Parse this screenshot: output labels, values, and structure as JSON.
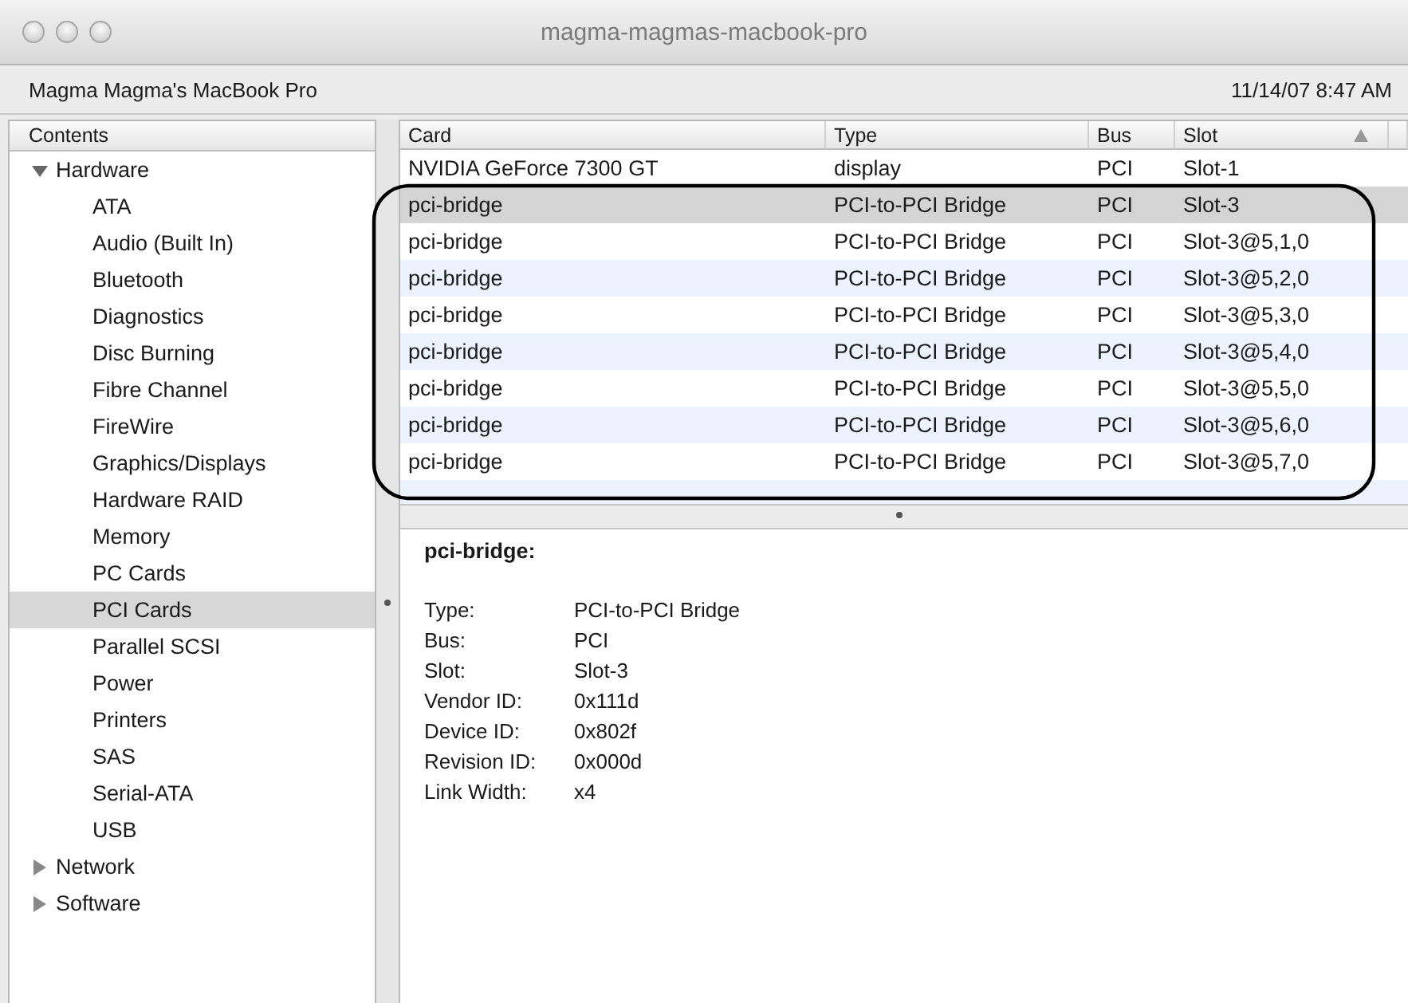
{
  "window": {
    "title": "magma-magmas-macbook-pro"
  },
  "info_bar": {
    "computer_name": "Magma Magma's MacBook Pro",
    "timestamp": "11/14/07 8:47 AM"
  },
  "sidebar": {
    "header": "Contents",
    "items": [
      {
        "label": "Hardware",
        "expanded": true,
        "selected": false,
        "children": [
          {
            "label": "ATA",
            "selected": false
          },
          {
            "label": "Audio (Built In)",
            "selected": false
          },
          {
            "label": "Bluetooth",
            "selected": false
          },
          {
            "label": "Diagnostics",
            "selected": false
          },
          {
            "label": "Disc Burning",
            "selected": false
          },
          {
            "label": "Fibre Channel",
            "selected": false
          },
          {
            "label": "FireWire",
            "selected": false
          },
          {
            "label": "Graphics/Displays",
            "selected": false
          },
          {
            "label": "Hardware RAID",
            "selected": false
          },
          {
            "label": "Memory",
            "selected": false
          },
          {
            "label": "PC Cards",
            "selected": false
          },
          {
            "label": "PCI Cards",
            "selected": true
          },
          {
            "label": "Parallel SCSI",
            "selected": false
          },
          {
            "label": "Power",
            "selected": false
          },
          {
            "label": "Printers",
            "selected": false
          },
          {
            "label": "SAS",
            "selected": false
          },
          {
            "label": "Serial-ATA",
            "selected": false
          },
          {
            "label": "USB",
            "selected": false
          }
        ]
      },
      {
        "label": "Network",
        "expanded": false,
        "selected": false
      },
      {
        "label": "Software",
        "expanded": false,
        "selected": false
      }
    ]
  },
  "table": {
    "columns": [
      {
        "label": "Card",
        "sorted": false
      },
      {
        "label": "Type",
        "sorted": false
      },
      {
        "label": "Bus",
        "sorted": false
      },
      {
        "label": "Slot",
        "sorted": true
      }
    ],
    "rows": [
      {
        "cells": [
          "NVIDIA GeForce 7300 GT",
          "display",
          "PCI",
          "Slot-1"
        ],
        "selected": false
      },
      {
        "cells": [
          "pci-bridge",
          "PCI-to-PCI Bridge",
          "PCI",
          "Slot-3"
        ],
        "selected": true
      },
      {
        "cells": [
          "pci-bridge",
          "PCI-to-PCI Bridge",
          "PCI",
          "Slot-3@5,1,0"
        ],
        "selected": false
      },
      {
        "cells": [
          "pci-bridge",
          "PCI-to-PCI Bridge",
          "PCI",
          "Slot-3@5,2,0"
        ],
        "selected": false
      },
      {
        "cells": [
          "pci-bridge",
          "PCI-to-PCI Bridge",
          "PCI",
          "Slot-3@5,3,0"
        ],
        "selected": false
      },
      {
        "cells": [
          "pci-bridge",
          "PCI-to-PCI Bridge",
          "PCI",
          "Slot-3@5,4,0"
        ],
        "selected": false
      },
      {
        "cells": [
          "pci-bridge",
          "PCI-to-PCI Bridge",
          "PCI",
          "Slot-3@5,5,0"
        ],
        "selected": false
      },
      {
        "cells": [
          "pci-bridge",
          "PCI-to-PCI Bridge",
          "PCI",
          "Slot-3@5,6,0"
        ],
        "selected": false
      },
      {
        "cells": [
          "pci-bridge",
          "PCI-to-PCI Bridge",
          "PCI",
          "Slot-3@5,7,0"
        ],
        "selected": false
      }
    ]
  },
  "detail": {
    "title": "pci-bridge:",
    "fields": [
      {
        "label": "Type:",
        "value": "PCI-to-PCI Bridge"
      },
      {
        "label": "Bus:",
        "value": "PCI"
      },
      {
        "label": "Slot:",
        "value": "Slot-3"
      },
      {
        "label": "Vendor ID:",
        "value": "0x111d"
      },
      {
        "label": "Device ID:",
        "value": "0x802f"
      },
      {
        "label": "Revision ID:",
        "value": "0x000d"
      },
      {
        "label": "Link Width:",
        "value": "x4"
      }
    ]
  }
}
